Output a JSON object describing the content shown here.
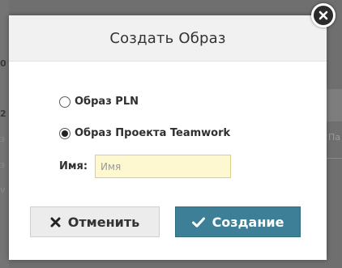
{
  "dialog": {
    "title": "Создать Образ",
    "options": [
      {
        "label": "Образ PLN",
        "checked": false
      },
      {
        "label": "Образ Проекта Teamwork",
        "checked": true
      }
    ],
    "name_field": {
      "label": "Имя:",
      "value": "",
      "placeholder": "Имя"
    },
    "buttons": {
      "cancel_label": "Отменить",
      "create_label": "Создание"
    },
    "icons": {
      "close": "close-icon",
      "cancel": "x-icon",
      "create": "checkmark-icon"
    }
  },
  "background": {
    "left_digits": [
      "0",
      "2"
    ],
    "left_marks": [
      "з",
      "з",
      "v"
    ],
    "right_text": "Па"
  },
  "colors": {
    "create_button": "#3d7f97",
    "input_background": "#fdf8d0",
    "overlay": "#6f6f6f"
  }
}
